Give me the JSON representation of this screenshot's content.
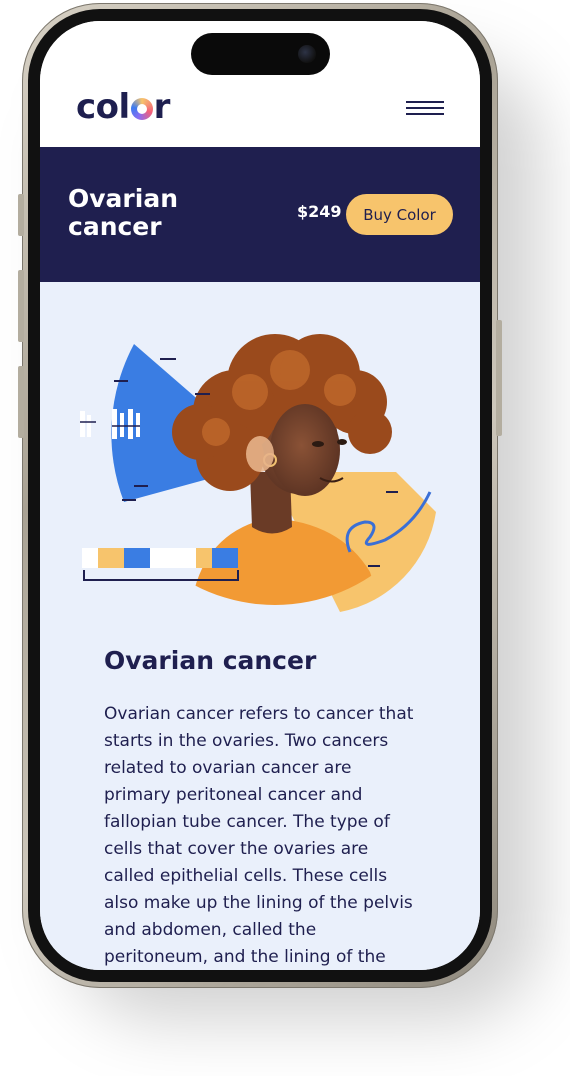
{
  "nav": {
    "logo": {
      "prefix": "col",
      "suffix": "r"
    },
    "menu_icon": "hamburger-menu-icon"
  },
  "banner": {
    "title": "Ovarian cancer",
    "price": "$249",
    "buy_label": "Buy Color"
  },
  "article": {
    "title": "Ovarian cancer",
    "body": "Ovarian cancer refers to cancer that starts in the ovaries. Two cancers related to ovarian cancer are primary peritoneal cancer and fallopian tube cancer. The type of cells that cover the ovaries are called epithelial cells. These cells also make up the lining of the pelvis and abdomen, called the peritoneum, and the lining of the"
  },
  "colors": {
    "navy": "#1f1f4f",
    "accent_yellow": "#f7c46c",
    "accent_blue": "#3a7de3",
    "page_background": "#eaf0fb"
  }
}
